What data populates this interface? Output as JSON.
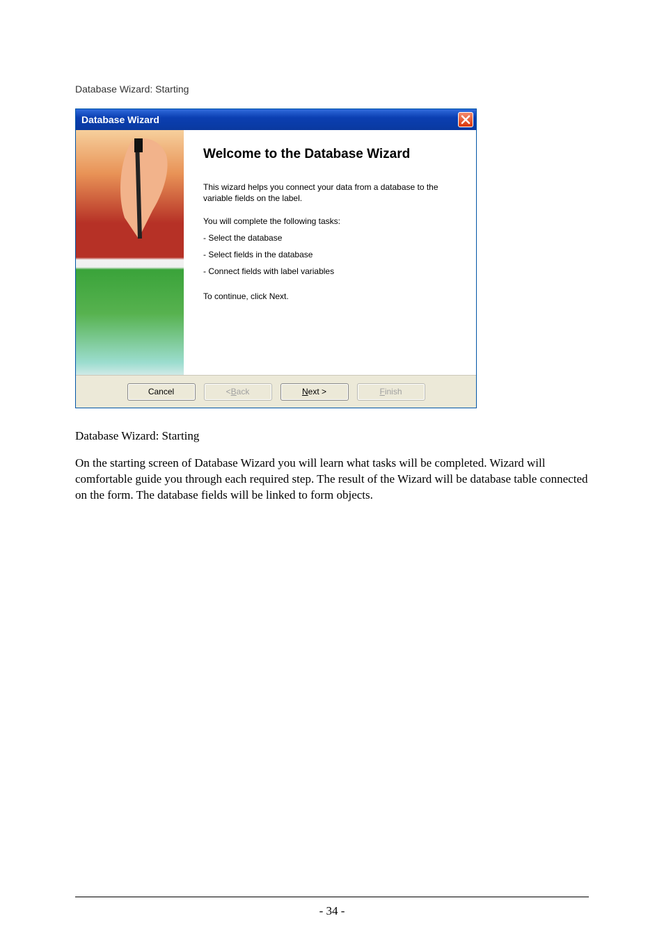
{
  "section_heading": "Database Wizard: Starting",
  "dialog": {
    "title": "Database Wizard",
    "heading": "Welcome to the Database Wizard",
    "intro": "This wizard helps you connect your data from a database to the variable fields on the label.",
    "tasks_lead": "You will complete the following tasks:",
    "tasks": [
      "- Select the database",
      "- Select fields in the database",
      "- Connect fields with label variables"
    ],
    "continue": "To continue, click Next.",
    "buttons": {
      "cancel": "Cancel",
      "back_prefix": "< ",
      "back_u": "B",
      "back_rest": "ack",
      "next_u": "N",
      "next_rest": "ext >",
      "finish_u": "F",
      "finish_rest": "inish"
    }
  },
  "caption": "Database Wizard: Starting",
  "body_paragraph": "On the starting screen of Database Wizard you will learn what tasks will be completed. Wizard will comfortable guide you through each required step. The result of the Wizard will be database table connected on the form. The database fields will be linked to form objects.",
  "page_number": "- 34 -"
}
